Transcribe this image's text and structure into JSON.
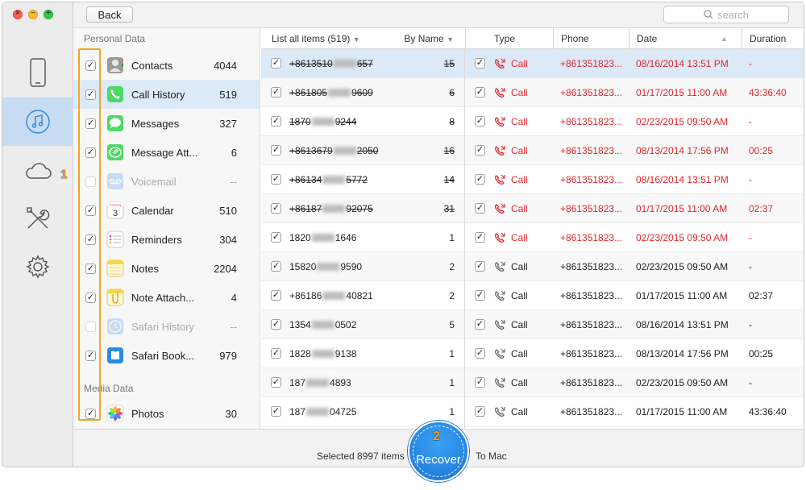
{
  "toolbar": {
    "back_label": "Back",
    "search_placeholder": "search"
  },
  "sections": {
    "personal": "Personal Data",
    "media": "Media Data"
  },
  "categories": [
    {
      "name": "Contacts",
      "count": "4044",
      "checked": true,
      "icon": "contacts-icon"
    },
    {
      "name": "Call History",
      "count": "519",
      "checked": true,
      "icon": "phone-icon"
    },
    {
      "name": "Messages",
      "count": "327",
      "checked": true,
      "icon": "messages-icon"
    },
    {
      "name": "Message Att...",
      "count": "6",
      "checked": true,
      "icon": "message-attachment-icon"
    },
    {
      "name": "Voicemail",
      "count": "--",
      "checked": false,
      "icon": "voicemail-icon"
    },
    {
      "name": "Calendar",
      "count": "510",
      "checked": true,
      "icon": "calendar-icon"
    },
    {
      "name": "Reminders",
      "count": "304",
      "checked": true,
      "icon": "reminders-icon"
    },
    {
      "name": "Notes",
      "count": "2204",
      "checked": true,
      "icon": "notes-icon"
    },
    {
      "name": "Note Attach...",
      "count": "4",
      "checked": true,
      "icon": "note-attachment-icon"
    },
    {
      "name": "Safari History",
      "count": "--",
      "checked": false,
      "icon": "safari-history-icon"
    },
    {
      "name": "Safari Book...",
      "count": "979",
      "checked": true,
      "icon": "safari-bookmark-icon"
    },
    {
      "name": "Photos",
      "count": "30",
      "checked": true,
      "icon": "photos-icon"
    }
  ],
  "calendar_icon_day": "3",
  "list_header": {
    "list_all": "List all items (519)",
    "by_name": "By Name"
  },
  "detail_header": {
    "type": "Type",
    "phone": "Phone",
    "date": "Date",
    "duration": "Duration"
  },
  "list_rows": [
    {
      "a": "+8613510",
      "b": "657",
      "count": "15",
      "strike": true
    },
    {
      "a": "+861805",
      "b": "9609",
      "count": "6",
      "strike": true
    },
    {
      "a": "1870",
      "b": "9244",
      "count": "8",
      "strike": true
    },
    {
      "a": "+8613679",
      "b": "2050",
      "count": "16",
      "strike": true
    },
    {
      "a": "+86134",
      "b": "5772",
      "count": "14",
      "strike": true
    },
    {
      "a": "+86187",
      "b": "92075",
      "count": "31",
      "strike": true
    },
    {
      "a": "1820",
      "b": "1646",
      "count": "1",
      "strike": false
    },
    {
      "a": "15820",
      "b": "9590",
      "count": "2",
      "strike": false
    },
    {
      "a": "+86186",
      "b": "40821",
      "count": "2",
      "strike": false
    },
    {
      "a": "1354",
      "b": "0502",
      "count": "5",
      "strike": false
    },
    {
      "a": "1828",
      "b": "9138",
      "count": "1",
      "strike": false
    },
    {
      "a": "187",
      "b": "4893",
      "count": "1",
      "strike": false
    },
    {
      "a": "187",
      "b": "04725",
      "count": "1",
      "strike": false
    }
  ],
  "detail_rows": [
    {
      "type": "Call",
      "phone": "+861351823...",
      "date": "08/16/2014 13:51 PM",
      "duration": "-",
      "deleted": true
    },
    {
      "type": "Call",
      "phone": "+861351823...",
      "date": "01/17/2015 11:00 AM",
      "duration": "43:36:40",
      "deleted": true
    },
    {
      "type": "Call",
      "phone": "+861351823...",
      "date": "02/23/2015 09:50 AM",
      "duration": "-",
      "deleted": true
    },
    {
      "type": "Call",
      "phone": "+861351823...",
      "date": "08/13/2014 17:56 PM",
      "duration": "00:25",
      "deleted": true
    },
    {
      "type": "Call",
      "phone": "+861351823...",
      "date": "08/16/2014 13:51 PM",
      "duration": "-",
      "deleted": true
    },
    {
      "type": "Call",
      "phone": "+861351823...",
      "date": "01/17/2015 11:00 AM",
      "duration": "02:37",
      "deleted": true
    },
    {
      "type": "Call",
      "phone": "+861351823...",
      "date": "02/23/2015 09:50 AM",
      "duration": "-",
      "deleted": true
    },
    {
      "type": "Call",
      "phone": "+861351823...",
      "date": "02/23/2015 09:50 AM",
      "duration": "-",
      "deleted": false
    },
    {
      "type": "Call",
      "phone": "+861351823...",
      "date": "01/17/2015 11:00 AM",
      "duration": "02:37",
      "deleted": false
    },
    {
      "type": "Call",
      "phone": "+861351823...",
      "date": "08/16/2014 13:51 PM",
      "duration": "-",
      "deleted": false
    },
    {
      "type": "Call",
      "phone": "+861351823...",
      "date": "08/13/2014 17:56 PM",
      "duration": "00:25",
      "deleted": false
    },
    {
      "type": "Call",
      "phone": "+861351823...",
      "date": "02/23/2015 09:50 AM",
      "duration": "-",
      "deleted": false
    },
    {
      "type": "Call",
      "phone": "+861351823...",
      "date": "01/17/2015 11:00 AM",
      "duration": "43:36:40",
      "deleted": false
    }
  ],
  "bottom": {
    "selected": "Selected 8997 items",
    "recover": "Recover",
    "to_mac": "To Mac"
  },
  "markers": {
    "step1": "1",
    "step2": "2"
  },
  "colors": {
    "accent": "#2f86d8",
    "deleted_red": "#e0262b",
    "highlight_orange": "#f5a623",
    "selected_row": "#dce9f7"
  }
}
